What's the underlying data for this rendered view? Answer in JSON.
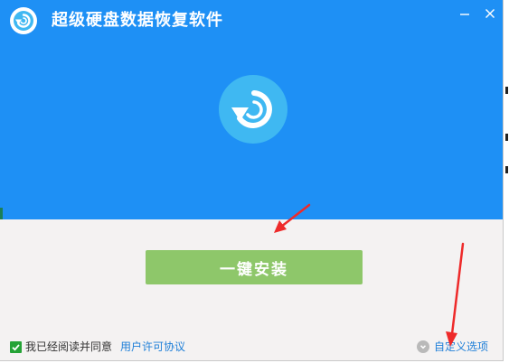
{
  "window": {
    "title": "超级硬盘数据恢复软件",
    "minimize_glyph": "—",
    "close_glyph": "✕"
  },
  "icons": {
    "app_logo": "restore-arrow-icon",
    "big_logo": "restore-arrow-icon",
    "minimize": "minimize-icon",
    "close": "close-icon",
    "checkbox": "checkmark-icon",
    "custom_options": "chevron-down-icon"
  },
  "main": {
    "install_button_label": "一键安装"
  },
  "footer": {
    "agree_checked": true,
    "agree_text": "我已经阅读并同意",
    "license_link": "用户许可协议",
    "custom_options_label": "自定义选项"
  },
  "colors": {
    "header_bg": "#1e90f5",
    "body_bg": "#f4f2f2",
    "install_button": "#8ec76a",
    "logo_circle": "#3fb8f2",
    "link": "#1e7fd8",
    "checkbox": "#25a336",
    "annotation_arrow": "#ee2a2a"
  }
}
